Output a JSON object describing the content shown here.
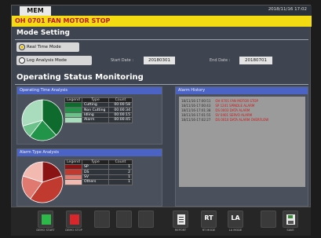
{
  "header": {
    "tab": "MEM",
    "datetime": "2018/11/16 17:02"
  },
  "alarm_banner": "OH 0701 FAN MOTOR STOP",
  "mode_setting": {
    "title": "Mode Setting",
    "real_time_label": "Real Time Mode",
    "log_analysis_label": "Log Analysis Mode",
    "selected": "real_time",
    "start_label": "Start Date :",
    "start_value": "20180301",
    "end_label": "End Date :",
    "end_value": "20180701"
  },
  "monitoring": {
    "title": "Operating Status Monitoring",
    "operating_time": {
      "title": "Operating Time Analysis",
      "headers": {
        "legend": "Legend",
        "type": "Type",
        "count": "Count"
      },
      "rows": [
        {
          "type": "Cutting",
          "count": "00:00:58",
          "color": "#0e6b2d"
        },
        {
          "type": "Non Cutting",
          "count": "00:00:34",
          "color": "#22944a"
        },
        {
          "type": "Idling",
          "count": "00:00:15",
          "color": "#6cc08a"
        },
        {
          "type": "Alarm",
          "count": "00:00:45",
          "color": "#a9dcbc"
        }
      ]
    },
    "alarm_type": {
      "title": "Alarm Type Analysis",
      "headers": {
        "legend": "Legend",
        "type": "Type",
        "count": "Count"
      },
      "rows": [
        {
          "type": "SP",
          "count": "1",
          "color": "#8a1414"
        },
        {
          "type": "DS",
          "count": "2",
          "color": "#c03a30"
        },
        {
          "type": "SV",
          "count": "1",
          "color": "#e07a70"
        },
        {
          "type": "Others",
          "count": "1",
          "color": "#f2b9b0"
        }
      ]
    },
    "alarm_history": {
      "title": "Alarm History",
      "entries": [
        {
          "time": "18/11/16-17:00:51",
          "message": "OH 0701 FAN MOTOR STOP"
        },
        {
          "time": "18/11/16-17:00:43",
          "message": "SP 1241 SPINDLE ALARM"
        },
        {
          "time": "18/11/16-17:01:38",
          "message": "DS 0003 DATA ALARM"
        },
        {
          "time": "18/11/16-17:01:55",
          "message": "SV 0401 SERVO ALARM"
        },
        {
          "time": "18/11/16-17:02:27",
          "message": "DS 0010 DATA ALARM OVERFLOW"
        }
      ]
    }
  },
  "bottom_bar": {
    "demo_start": {
      "label": "DEMO START",
      "color": "#2db84a"
    },
    "demo_stop": {
      "label": "DEMO STOP",
      "color": "#d8262a"
    },
    "report": {
      "label": "REPORT",
      "icon": "report-icon"
    },
    "rt_mode": {
      "label": "RT MODE",
      "glyph": "RT"
    },
    "la_mode": {
      "label": "LA MODE",
      "glyph": "LA"
    },
    "save": {
      "label": "SAVE",
      "icon": "save-icon"
    }
  }
}
